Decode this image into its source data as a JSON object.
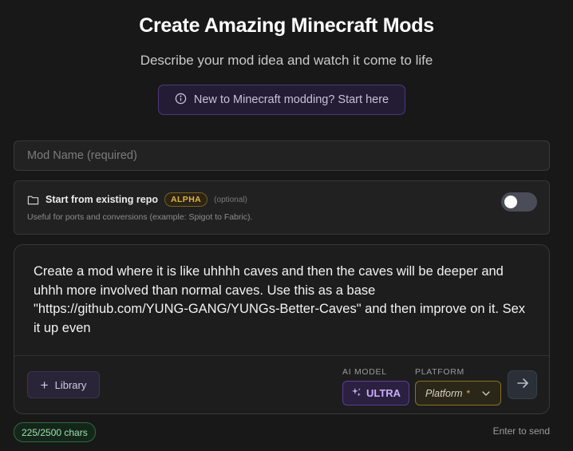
{
  "header": {
    "title": "Create Amazing Minecraft Mods",
    "subtitle": "Describe your mod idea and watch it come to life",
    "help_button_label": "New to Minecraft modding? Start here",
    "help_icon": "info-icon"
  },
  "mod_name": {
    "value": "",
    "placeholder": "Mod Name (required)"
  },
  "repo": {
    "icon": "folder-icon",
    "title": "Start from existing repo",
    "badge": "ALPHA",
    "optional_label": "(optional)",
    "description": "Useful for ports and conversions (example: Spigot to Fabric).",
    "toggle_on": false
  },
  "prompt": {
    "text": "Create a mod where it is like uhhhh caves and then the caves will be deeper and uhhh more involved than normal caves. Use this as a base \"https://github.com/YUNG-GANG/YUNGs-Better-Caves\" and then improve on it. Sex it up even"
  },
  "toolbar": {
    "library_label": "Library",
    "ai_model_label": "AI MODEL",
    "ai_model_value": "ULTRA",
    "platform_label": "PLATFORM",
    "platform_placeholder": "Platform",
    "platform_required_mark": "*",
    "send_icon": "arrow-right-icon"
  },
  "footer": {
    "char_count": "225/2500 chars",
    "hint": "Enter to send"
  },
  "colors": {
    "background": "#181818",
    "accent_purple": "#5a3f93",
    "accent_gold": "#e0b24a",
    "success_green": "#9ee0b0"
  }
}
